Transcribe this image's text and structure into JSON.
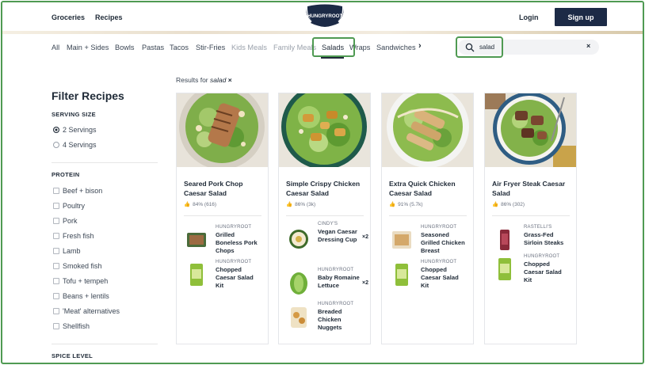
{
  "header": {
    "nav": [
      "Groceries",
      "Recipes"
    ],
    "logo_text": "HUNGRYROOT",
    "login_label": "Login",
    "signup_label": "Sign up"
  },
  "categories": [
    "All",
    "Main + Sides",
    "Bowls",
    "Pastas",
    "Tacos",
    "Stir-Fries",
    "Kids Meals",
    "Family Meals",
    "Salads",
    "Wraps",
    "Sandwiches"
  ],
  "active_category": "Salads",
  "search": {
    "value": "salad",
    "clear_symbol": "×"
  },
  "results": {
    "prefix": "Results for",
    "query": "salad",
    "clear_symbol": "×"
  },
  "sidebar": {
    "title": "Filter Recipes",
    "serving_title": "SERVING SIZE",
    "servings": [
      "2 Servings",
      "4 Servings"
    ],
    "selected_serving": "2 Servings",
    "protein_title": "PROTEIN",
    "proteins": [
      "Beef + bison",
      "Poultry",
      "Pork",
      "Fresh fish",
      "Lamb",
      "Smoked fish",
      "Tofu + tempeh",
      "Beans + lentils",
      "'Meat' alternatives",
      "Shellfish"
    ],
    "spice_title": "SPICE LEVEL"
  },
  "cards": [
    {
      "title": "Seared Pork Chop Caesar Salad",
      "rating": "84% (616)",
      "items": [
        {
          "brand": "HUNGRYROOT",
          "name": "Grilled Boneless Pork Chops",
          "qty": ""
        },
        {
          "brand": "HUNGRYROOT",
          "name": "Chopped Caesar Salad Kit",
          "qty": ""
        }
      ]
    },
    {
      "title": "Simple Crispy Chicken Caesar Salad",
      "rating": "86% (3k)",
      "items": [
        {
          "brand": "CINDY'S",
          "name": "Vegan Caesar Dressing Cup",
          "qty": "×2"
        },
        {
          "brand": "HUNGRYROOT",
          "name": "Baby Romaine Lettuce",
          "qty": "×2"
        },
        {
          "brand": "HUNGRYROOT",
          "name": "Breaded Chicken Nuggets",
          "qty": ""
        }
      ]
    },
    {
      "title": "Extra Quick Chicken Caesar Salad",
      "rating": "91% (5.7k)",
      "items": [
        {
          "brand": "HUNGRYROOT",
          "name": "Seasoned Grilled Chicken Breast",
          "qty": ""
        },
        {
          "brand": "HUNGRYROOT",
          "name": "Chopped Caesar Salad Kit",
          "qty": ""
        }
      ]
    },
    {
      "title": "Air Fryer Steak Caesar Salad",
      "rating": "86% (302)",
      "items": [
        {
          "brand": "RASTELLI'S",
          "name": "Grass-Fed Sirloin Steaks",
          "qty": ""
        },
        {
          "brand": "HUNGRYROOT",
          "name": "Chopped Caesar Salad Kit",
          "qty": ""
        }
      ]
    }
  ],
  "colors": {
    "highlight": "#4f9a52",
    "signup_bg": "#1c2a46",
    "text": "#1f2a37"
  }
}
